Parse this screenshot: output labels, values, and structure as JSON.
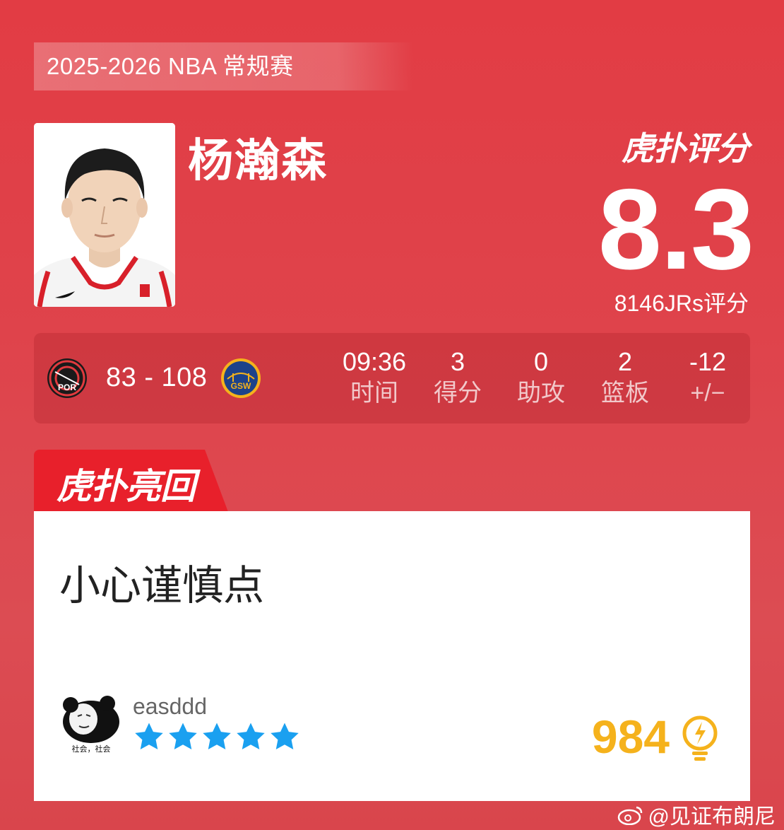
{
  "season": "2025-2026 NBA 常规赛",
  "player": {
    "name": "杨瀚森"
  },
  "rating": {
    "brand": "虎扑评分",
    "score": "8.3",
    "count_text": "8146JRs评分"
  },
  "game": {
    "home_team": "POR",
    "away_team": "GSW",
    "score": "83 - 108",
    "stats": [
      {
        "value": "09:36",
        "label": "时间"
      },
      {
        "value": "3",
        "label": "得分"
      },
      {
        "value": "0",
        "label": "助攻"
      },
      {
        "value": "2",
        "label": "篮板"
      },
      {
        "value": "-12",
        "label": "+/−"
      }
    ]
  },
  "hot_reply": {
    "tab_label": "虎扑亮回复",
    "text": "小心谨慎点",
    "username": "easddd",
    "avatar_caption": "社会，社会",
    "stars": 5,
    "likes": "984"
  },
  "watermark": "@见证布朗尼",
  "colors": {
    "background": "#e03e46",
    "accent_red": "#e8202b",
    "star_blue": "#1aa0f0",
    "like_gold": "#f5b21c"
  }
}
